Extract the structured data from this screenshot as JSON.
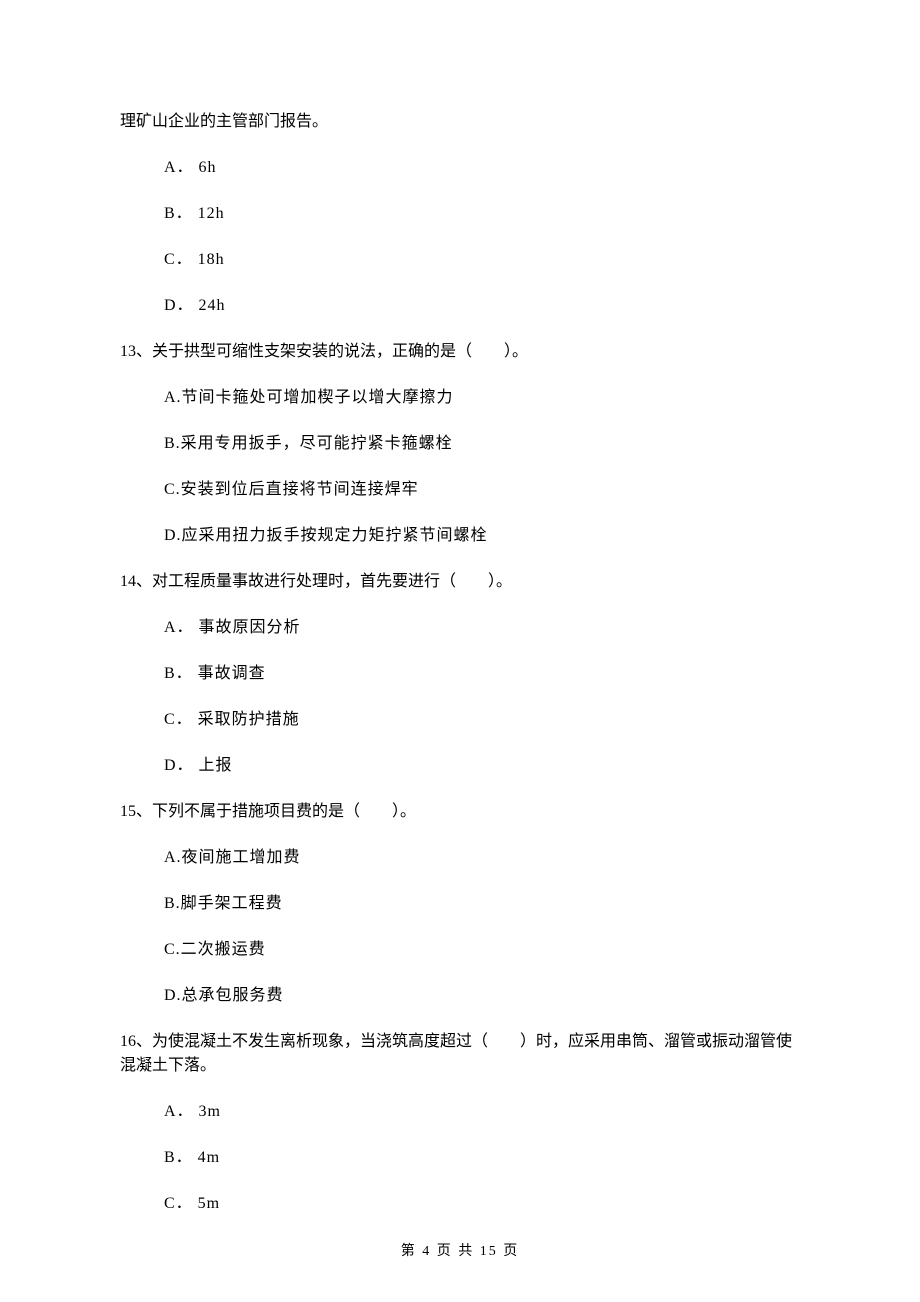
{
  "continuation": "理矿山企业的主管部门报告。",
  "q12": {
    "options": {
      "a": "A． 6h",
      "b": "B． 12h",
      "c": "C． 18h",
      "d": "D． 24h"
    }
  },
  "q13": {
    "stem": "13、关于拱型可缩性支架安装的说法，正确的是（　　）。",
    "options": {
      "a": "A.节间卡箍处可增加楔子以增大摩擦力",
      "b": "B.采用专用扳手，尽可能拧紧卡箍螺栓",
      "c": "C.安装到位后直接将节间连接焊牢",
      "d": "D.应采用扭力扳手按规定力矩拧紧节间螺栓"
    }
  },
  "q14": {
    "stem": "14、对工程质量事故进行处理时，首先要进行（　　）。",
    "options": {
      "a": "A． 事故原因分析",
      "b": "B． 事故调查",
      "c": "C． 采取防护措施",
      "d": "D． 上报"
    }
  },
  "q15": {
    "stem": "15、下列不属于措施项目费的是（　　）。",
    "options": {
      "a": "A.夜间施工增加费",
      "b": "B.脚手架工程费",
      "c": "C.二次搬运费",
      "d": "D.总承包服务费"
    }
  },
  "q16": {
    "stem": "16、为使混凝土不发生离析现象，当浇筑高度超过（　　）时，应采用串筒、溜管或振动溜管使混凝土下落。",
    "options": {
      "a": "A． 3m",
      "b": "B． 4m",
      "c": "C． 5m"
    }
  },
  "footer": "第 4 页 共 15 页"
}
